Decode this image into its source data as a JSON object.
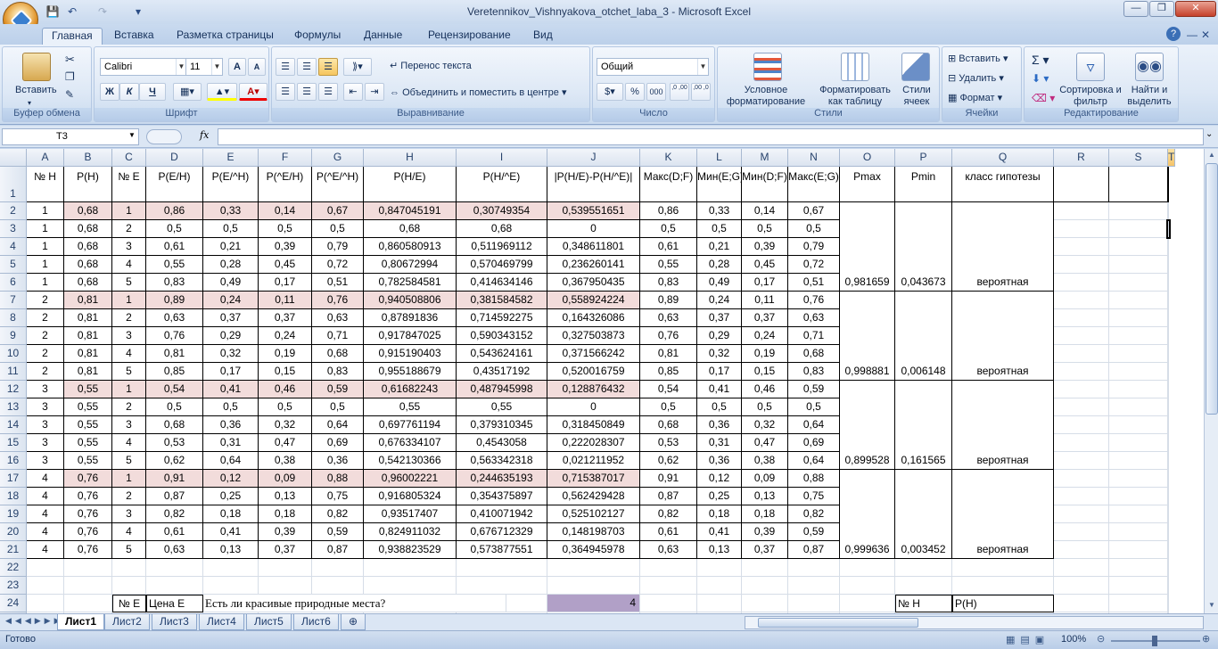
{
  "window": {
    "title": "Veretennikov_Vishnyakova_otchet_laba_3 - Microsoft Excel"
  },
  "tabs": [
    "Главная",
    "Вставка",
    "Разметка страницы",
    "Формулы",
    "Данные",
    "Рецензирование",
    "Вид"
  ],
  "ribbon": {
    "clipboard": {
      "label": "Буфер обмена",
      "paste": "Вставить"
    },
    "font": {
      "label": "Шрифт",
      "name": "Calibri",
      "size": "11",
      "bold": "Ж",
      "italic": "К",
      "underline": "Ч"
    },
    "alignment": {
      "label": "Выравнивание",
      "wrap": "Перенос текста",
      "merge": "Объединить и поместить в центре"
    },
    "number": {
      "label": "Число",
      "format": "Общий",
      "currency": "$",
      "percent": "%",
      "thousands": "000",
      "inc": ",0 ,00",
      "dec": ",00 ,0"
    },
    "styles": {
      "label": "Стили",
      "cond": "Условное форматирование",
      "table": "Форматировать как таблицу",
      "cell": "Стили ячеек"
    },
    "cells": {
      "label": "Ячейки",
      "insert": "Вставить",
      "delete": "Удалить",
      "format": "Формат"
    },
    "editing": {
      "label": "Редактирование",
      "sort": "Сортировка и фильтр",
      "find": "Найти и выделить"
    }
  },
  "namebox": "T3",
  "fx": "fx",
  "columns": [
    "A",
    "B",
    "C",
    "D",
    "E",
    "F",
    "G",
    "H",
    "I",
    "J",
    "K",
    "L",
    "M",
    "N",
    "O",
    "P",
    "Q",
    "R",
    "S",
    "T"
  ],
  "header_row": [
    "№ H",
    "P(H)",
    "№ E",
    "P(E/H)",
    "P(E/^H)",
    "P(^E/H)",
    "P(^E/^H)",
    "P(H/E)",
    "P(H/^E)",
    "|P(H/E)-P(H/^E)|",
    "Макс(D;F)",
    "Мин(E;G)",
    "Мин(D;F)",
    "Макс(E;G)",
    "Pmax",
    "Pmin",
    "класс гипотезы"
  ],
  "rows": [
    [
      "1",
      "0,68",
      "1",
      "0,86",
      "0,33",
      "0,14",
      "0,67",
      "0,847045191",
      "0,30749354",
      "0,539551651",
      "0,86",
      "0,33",
      "0,14",
      "0,67"
    ],
    [
      "1",
      "0,68",
      "2",
      "0,5",
      "0,5",
      "0,5",
      "0,5",
      "0,68",
      "0,68",
      "0",
      "0,5",
      "0,5",
      "0,5",
      "0,5"
    ],
    [
      "1",
      "0,68",
      "3",
      "0,61",
      "0,21",
      "0,39",
      "0,79",
      "0,860580913",
      "0,511969112",
      "0,348611801",
      "0,61",
      "0,21",
      "0,39",
      "0,79"
    ],
    [
      "1",
      "0,68",
      "4",
      "0,55",
      "0,28",
      "0,45",
      "0,72",
      "0,80672994",
      "0,570469799",
      "0,236260141",
      "0,55",
      "0,28",
      "0,45",
      "0,72"
    ],
    [
      "1",
      "0,68",
      "5",
      "0,83",
      "0,49",
      "0,17",
      "0,51",
      "0,782584581",
      "0,414634146",
      "0,367950435",
      "0,83",
      "0,49",
      "0,17",
      "0,51"
    ],
    [
      "2",
      "0,81",
      "1",
      "0,89",
      "0,24",
      "0,11",
      "0,76",
      "0,940508806",
      "0,381584582",
      "0,558924224",
      "0,89",
      "0,24",
      "0,11",
      "0,76"
    ],
    [
      "2",
      "0,81",
      "2",
      "0,63",
      "0,37",
      "0,37",
      "0,63",
      "0,87891836",
      "0,714592275",
      "0,164326086",
      "0,63",
      "0,37",
      "0,37",
      "0,63"
    ],
    [
      "2",
      "0,81",
      "3",
      "0,76",
      "0,29",
      "0,24",
      "0,71",
      "0,917847025",
      "0,590343152",
      "0,327503873",
      "0,76",
      "0,29",
      "0,24",
      "0,71"
    ],
    [
      "2",
      "0,81",
      "4",
      "0,81",
      "0,32",
      "0,19",
      "0,68",
      "0,915190403",
      "0,543624161",
      "0,371566242",
      "0,81",
      "0,32",
      "0,19",
      "0,68"
    ],
    [
      "2",
      "0,81",
      "5",
      "0,85",
      "0,17",
      "0,15",
      "0,83",
      "0,955188679",
      "0,43517192",
      "0,520016759",
      "0,85",
      "0,17",
      "0,15",
      "0,83"
    ],
    [
      "3",
      "0,55",
      "1",
      "0,54",
      "0,41",
      "0,46",
      "0,59",
      "0,61682243",
      "0,487945998",
      "0,128876432",
      "0,54",
      "0,41",
      "0,46",
      "0,59"
    ],
    [
      "3",
      "0,55",
      "2",
      "0,5",
      "0,5",
      "0,5",
      "0,5",
      "0,55",
      "0,55",
      "0",
      "0,5",
      "0,5",
      "0,5",
      "0,5"
    ],
    [
      "3",
      "0,55",
      "3",
      "0,68",
      "0,36",
      "0,32",
      "0,64",
      "0,697761194",
      "0,379310345",
      "0,318450849",
      "0,68",
      "0,36",
      "0,32",
      "0,64"
    ],
    [
      "3",
      "0,55",
      "4",
      "0,53",
      "0,31",
      "0,47",
      "0,69",
      "0,676334107",
      "0,4543058",
      "0,222028307",
      "0,53",
      "0,31",
      "0,47",
      "0,69"
    ],
    [
      "3",
      "0,55",
      "5",
      "0,62",
      "0,64",
      "0,38",
      "0,36",
      "0,542130366",
      "0,563342318",
      "0,021211952",
      "0,62",
      "0,36",
      "0,38",
      "0,64"
    ],
    [
      "4",
      "0,76",
      "1",
      "0,91",
      "0,12",
      "0,09",
      "0,88",
      "0,96002221",
      "0,244635193",
      "0,715387017",
      "0,91",
      "0,12",
      "0,09",
      "0,88"
    ],
    [
      "4",
      "0,76",
      "2",
      "0,87",
      "0,25",
      "0,13",
      "0,75",
      "0,916805324",
      "0,354375897",
      "0,562429428",
      "0,87",
      "0,25",
      "0,13",
      "0,75"
    ],
    [
      "4",
      "0,76",
      "3",
      "0,82",
      "0,18",
      "0,18",
      "0,82",
      "0,93517407",
      "0,410071942",
      "0,525102127",
      "0,82",
      "0,18",
      "0,18",
      "0,82"
    ],
    [
      "4",
      "0,76",
      "4",
      "0,61",
      "0,41",
      "0,39",
      "0,59",
      "0,824911032",
      "0,676712329",
      "0,148198703",
      "0,61",
      "0,41",
      "0,39",
      "0,59"
    ],
    [
      "4",
      "0,76",
      "5",
      "0,63",
      "0,13",
      "0,37",
      "0,87",
      "0,938823529",
      "0,573877551",
      "0,364945978",
      "0,63",
      "0,13",
      "0,37",
      "0,87"
    ]
  ],
  "summary": [
    {
      "row": 6,
      "pmax": "0,981659",
      "pmin": "0,043673",
      "cls": "вероятная"
    },
    {
      "row": 11,
      "pmax": "0,998881",
      "pmin": "0,006148",
      "cls": "вероятная"
    },
    {
      "row": 16,
      "pmax": "0,899528",
      "pmin": "0,161565",
      "cls": "вероятная"
    },
    {
      "row": 21,
      "pmax": "0,999636",
      "pmin": "0,003452",
      "cls": "вероятная"
    }
  ],
  "row24": {
    "c": "№ E",
    "d": "Цена E",
    "e": "Есть ли красивые природные места?",
    "j": "4",
    "p": "№ H",
    "q": "P(H)"
  },
  "sheets": [
    "Лист1",
    "Лист2",
    "Лист3",
    "Лист4",
    "Лист5",
    "Лист6"
  ],
  "status": {
    "ready": "Готово",
    "zoom": "100%"
  }
}
